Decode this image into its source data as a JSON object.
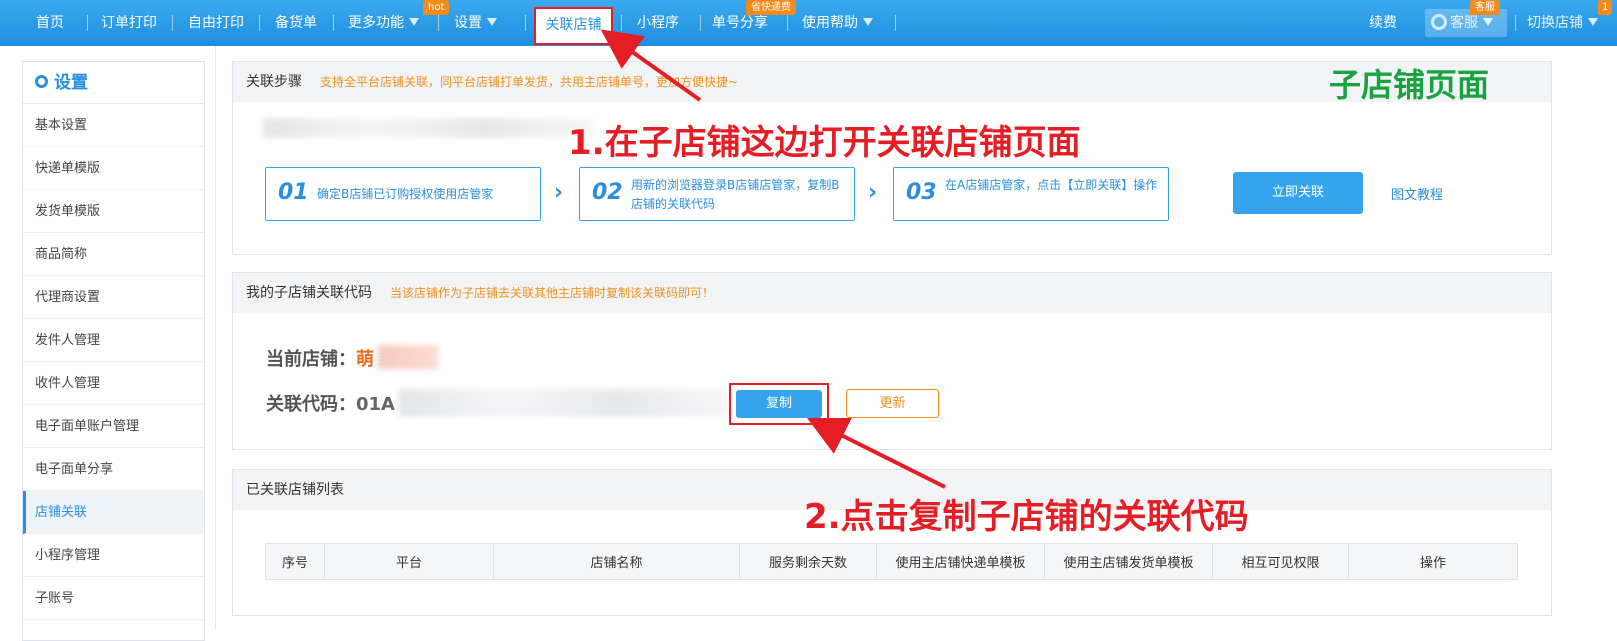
{
  "topnav": {
    "items": [
      "首页",
      "订单打印",
      "自由打印",
      "备货单",
      "更多功能",
      "设置",
      "关联店铺",
      "小程序",
      "单号分享",
      "使用帮助"
    ],
    "tag_hot": "hot",
    "tag_share": "省快递费",
    "right": {
      "renew": "续费",
      "service": "客服",
      "service_tag": "客服",
      "switch_shop": "切换店铺",
      "switch_badge": "1"
    }
  },
  "sidebar": {
    "title": "设置",
    "items": [
      "基本设置",
      "快递单模版",
      "发货单模版",
      "商品简称",
      "代理商设置",
      "发件人管理",
      "收件人管理",
      "电子面单账户管理",
      "电子面单分享",
      "店铺关联",
      "小程序管理",
      "子账号"
    ],
    "active": "店铺关联"
  },
  "steps_panel": {
    "title": "关联步骤",
    "hint": "支持全平台店铺关联，同平台店铺打单发货，共用主店铺单号，更加方便快捷~",
    "steps": [
      {
        "num": "01",
        "text": "确定B店铺已订购授权使用店管家"
      },
      {
        "num": "02",
        "text": "用新的浏览器登录B店铺店管家，复制B店铺的关联代码"
      },
      {
        "num": "03",
        "text": "在A店铺店管家，点击【立即关联】操作"
      }
    ],
    "link_now": "立即关联",
    "tutorial": "图文教程"
  },
  "code_panel": {
    "title": "我的子店铺关联代码",
    "hint": "当该店铺作为子店铺去关联其他主店铺时复制该关联码即可！",
    "current_shop_label": "当前店铺：",
    "current_shop_value": "萌",
    "code_label": "关联代码：",
    "code_value": "01A",
    "copy": "复制",
    "refresh": "更新"
  },
  "list_panel": {
    "title": "已关联店铺列表",
    "columns": [
      "序号",
      "平台",
      "店铺名称",
      "服务剩余天数",
      "使用主店铺快递单模板",
      "使用主店铺发货单模板",
      "相互可见权限",
      "操作"
    ]
  },
  "annotations": {
    "page_label": "子店铺页面",
    "step1": "1.在子店铺这边打开关联店铺页面",
    "step2": "2.点击复制子店铺的关联代码"
  },
  "colors": {
    "nav_blue": "#1e8fe0",
    "accent_orange": "#f0901a",
    "annot_red": "#e51e25",
    "annot_green": "#19a340"
  }
}
